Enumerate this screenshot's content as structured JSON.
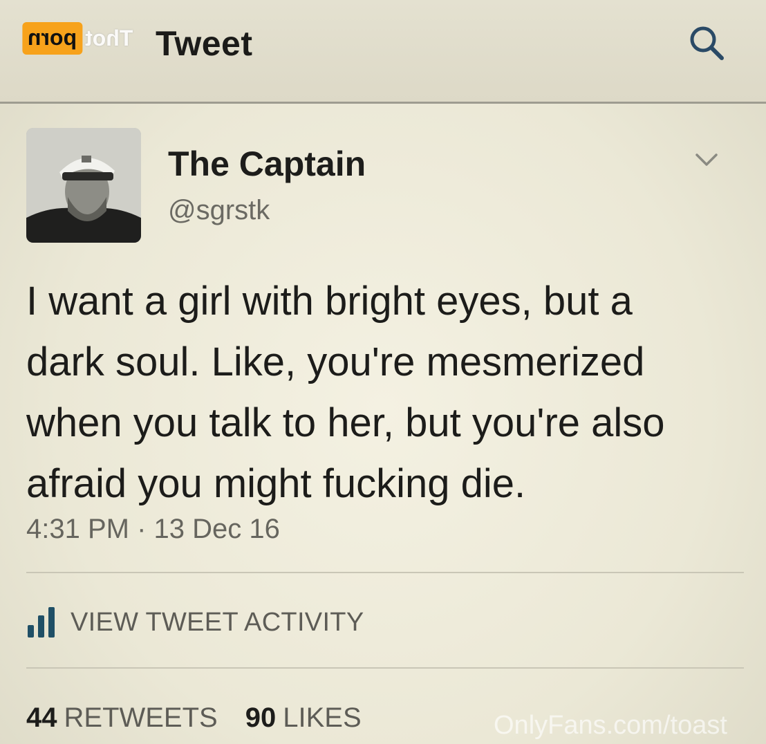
{
  "watermark": {
    "logo_left": "Thot",
    "logo_right": "porn",
    "bottom_text": "OnlyFans.com/toast"
  },
  "header": {
    "title": "Tweet",
    "search_icon": "search-icon"
  },
  "author": {
    "display_name": "The Captain",
    "handle": "@sgrstk",
    "avatar_icon": "profile-photo"
  },
  "tweet": {
    "text": "I want a girl with bright eyes, but a\ndark soul. Like, you're mesmerized\nwhen you talk to her, but you're also\nafraid you might fucking die.",
    "timestamp": "4:31 PM · 13 Dec 16"
  },
  "activity": {
    "label": "VIEW TWEET ACTIVITY",
    "icon": "bar-chart-icon"
  },
  "stats": {
    "retweets_count": "44",
    "retweets_label": "RETWEETS",
    "likes_count": "90",
    "likes_label": "LIKES"
  },
  "colors": {
    "background": "#efecdc",
    "text": "#1d1d1b",
    "muted": "#66655e",
    "accent_logo": "#f7a21b"
  }
}
